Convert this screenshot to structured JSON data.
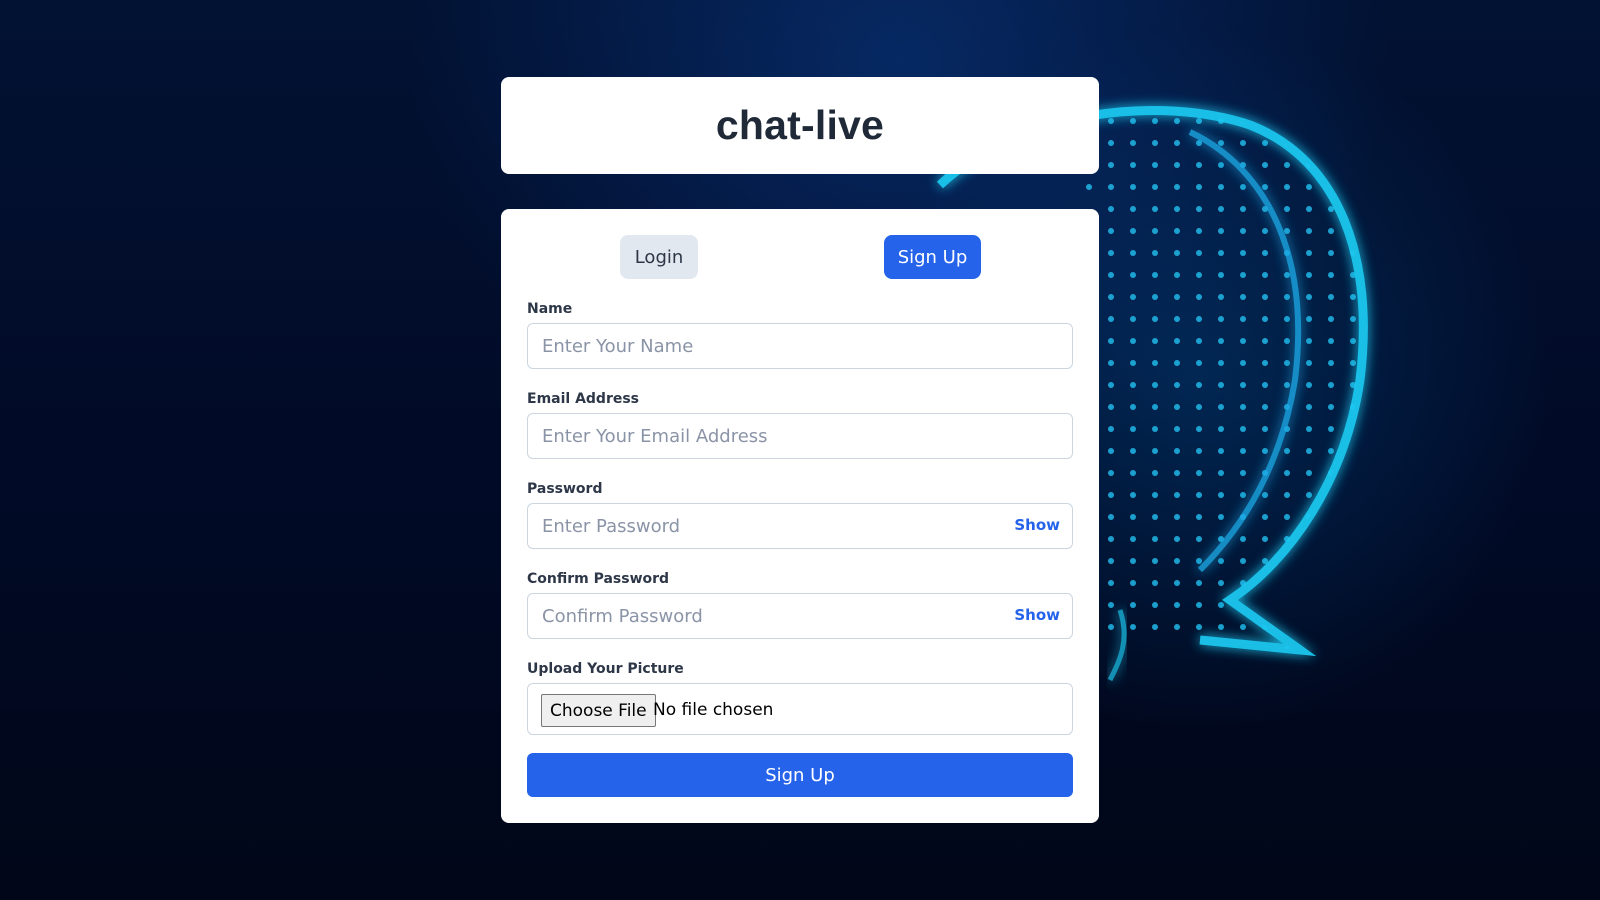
{
  "app": {
    "title": "chat-live"
  },
  "tabs": {
    "login_label": "Login",
    "signup_label": "Sign Up",
    "active": "Sign Up"
  },
  "form": {
    "name": {
      "label": "Name",
      "placeholder": "Enter Your Name",
      "value": ""
    },
    "email": {
      "label": "Email Address",
      "placeholder": "Enter Your Email Address",
      "value": ""
    },
    "password": {
      "label": "Password",
      "placeholder": "Enter Password",
      "value": "",
      "toggle_label": "Show"
    },
    "confirm_password": {
      "label": "Confirm Password",
      "placeholder": "Confirm Password",
      "value": "",
      "toggle_label": "Show"
    },
    "picture": {
      "label": "Upload Your Picture",
      "button_label": "Choose File",
      "status": "No file chosen"
    },
    "submit_label": "Sign Up"
  },
  "colors": {
    "accent": "#2563eb",
    "background": "#021233",
    "glow": "#1ec8f0"
  }
}
